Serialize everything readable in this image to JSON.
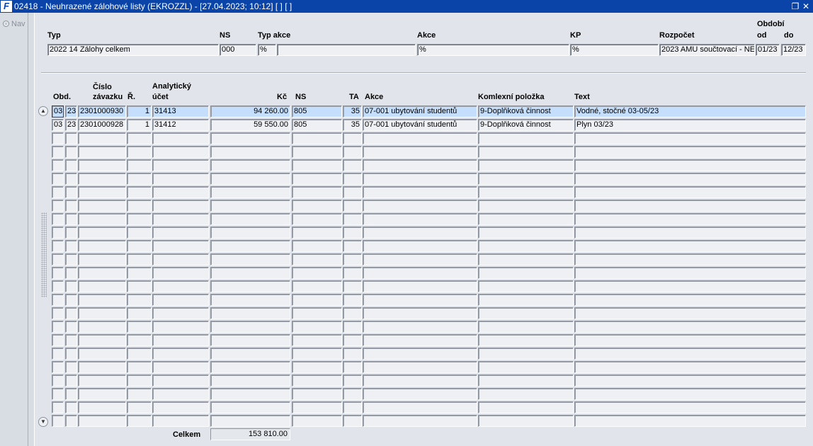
{
  "window": {
    "title": "02418 - Neuhrazené zálohové listy (EKROZZL) - [27.04.2023; 10:12] [ ] [ ]",
    "app_icon": "F",
    "restore_icon": "restore-icon",
    "close_icon": "close-icon"
  },
  "nav": {
    "label": "Nav"
  },
  "filter": {
    "labels": {
      "typ": "Typ",
      "ns": "NS",
      "typ_akce": "Typ akce",
      "akce": "Akce",
      "kp": "KP",
      "rozpocet": "Rozpočet",
      "obdobi": "Období",
      "od": "od",
      "do": "do"
    },
    "values": {
      "typ": "2022 14 Zálohy celkem",
      "ns": "000",
      "typ_akce": "%",
      "typ_akce_name": "",
      "akce": "%",
      "kp": "%",
      "rozpocet": "2023 AMU součtovací - NE",
      "od": "01/23",
      "do": "12/23"
    }
  },
  "table": {
    "headers": {
      "obd": "Obd.",
      "cislo": [
        "Číslo",
        "závazku"
      ],
      "r": "Ř.",
      "ucet": [
        "Analytický",
        "účet"
      ],
      "kc": "Kč",
      "ns": "NS",
      "ta": "TA",
      "akce": "Akce",
      "polozka": "Komlexní položka",
      "text": "Text"
    },
    "rows": [
      {
        "m": "03",
        "y": "23",
        "cislo": "2301000930",
        "r": "1",
        "ucet": "31413",
        "kc": "94 260.00",
        "ns": "805",
        "ta": "35",
        "akce": "07-001 ubytování studentů",
        "polozka": "9-Doplňková činnost",
        "text": "Vodné, stočné 03-05/23"
      },
      {
        "m": "03",
        "y": "23",
        "cislo": "2301000928",
        "r": "1",
        "ucet": "31412",
        "kc": "59 550.00",
        "ns": "805",
        "ta": "35",
        "akce": "07-001 ubytování studentů",
        "polozka": "9-Doplňková činnost",
        "text": "Plyn 03/23"
      }
    ],
    "empty_rows": 22,
    "total_label": "Celkem",
    "total_value": "153 810.00"
  }
}
